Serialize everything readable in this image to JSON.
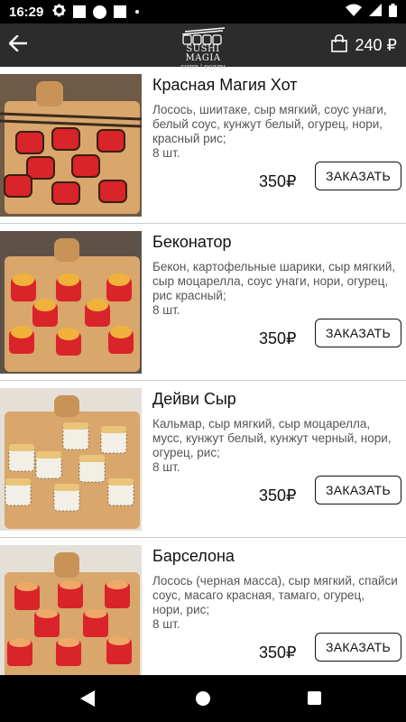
{
  "status_bar": {
    "time": "16:29",
    "icons": [
      "gear-icon",
      "square-icon",
      "circle-icon",
      "square-icon",
      "dot-icon",
      "wifi-icon",
      "signal-icon",
      "battery-icon"
    ]
  },
  "header": {
    "brand": "SUSHI MAGIA",
    "brand_sub": "суши | роллы",
    "cart_total": "240 ₽",
    "icons": [
      "back-arrow-icon",
      "shopping-bag-icon"
    ]
  },
  "products": [
    {
      "name": "Красная Магия Хот",
      "description": "Лосось, шиитаке, сыр мягкий, соус унаги, белый соус, кунжут белый, огурец, нори, красный рис;",
      "quantity": "8 шт.",
      "price": "350₽",
      "order_label": "ЗАКАЗАТЬ"
    },
    {
      "name": "Беконатор",
      "description": "Бекон, картофельные шарики, сыр мягкий, сыр моцарелла, соус унаги, нори, огурец, рис красный;",
      "quantity": "8 шт.",
      "price": "350₽",
      "order_label": "ЗАКАЗАТЬ"
    },
    {
      "name": "Дейви Сыр",
      "description": "Кальмар, сыр мягкий, сыр моцарелла, мусс, кунжут белый, кунжут черный, нори, огурец, рис;",
      "quantity": "8 шт.",
      "price": "350₽",
      "order_label": "ЗАКАЗАТЬ"
    },
    {
      "name": "Барселона",
      "description": "Лосось (черная масса), сыр мягкий, спайси соус, масаго красная, тамаго, огурец, нори, рис;",
      "quantity": "8 шт.",
      "price": "350₽",
      "order_label": "ЗАКАЗАТЬ"
    }
  ],
  "nav_bar": {
    "icons": [
      "nav-back-icon",
      "nav-home-icon",
      "nav-recents-icon"
    ]
  },
  "colors": {
    "app_bar": "#2c2c2c",
    "status_bar": "#000000",
    "divider": "#cfcfcf",
    "roll_red": "#d9242a",
    "roll_white": "#f2efe6",
    "board": "#d9a66b"
  }
}
